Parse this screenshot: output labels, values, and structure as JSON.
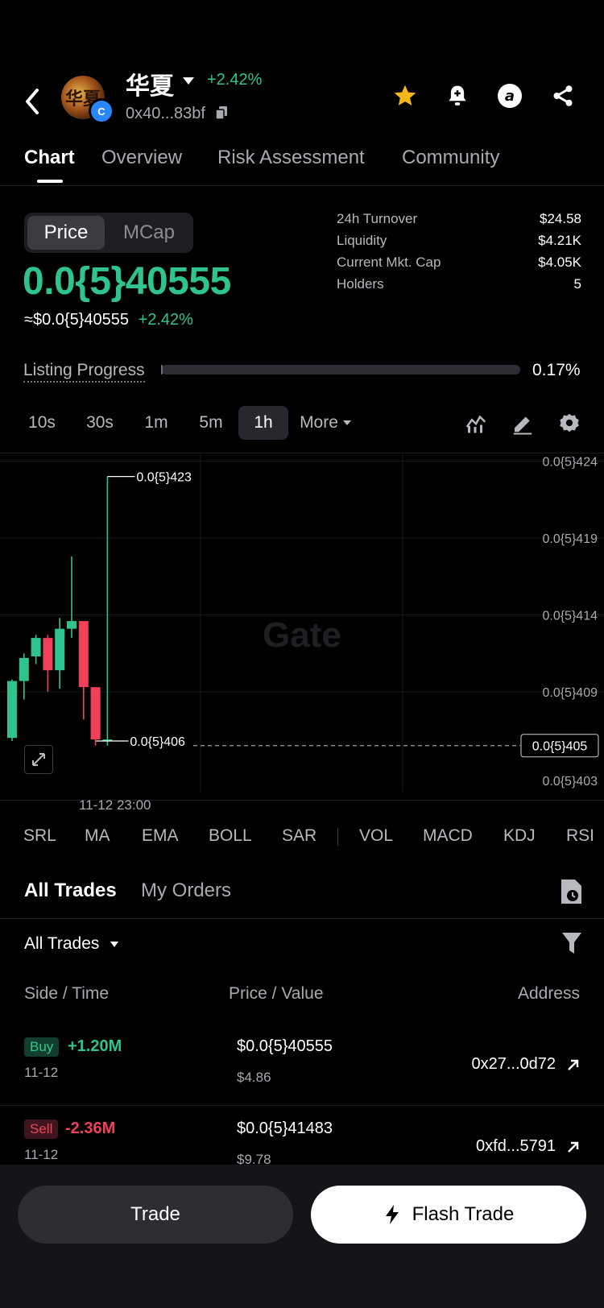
{
  "header": {
    "token_name": "华夏",
    "token_change": "+2.42%",
    "token_address": "0x40...83bf",
    "icons": [
      "back-arrow-icon",
      "star-icon",
      "bell-plus-icon",
      "alpha-icon",
      "share-icon"
    ]
  },
  "tabs": [
    "Chart",
    "Overview",
    "Risk Assessment",
    "Community"
  ],
  "price_toggle": {
    "price": "Price",
    "mcap": "MCap"
  },
  "price": {
    "main": "0.0{5}40555",
    "usd": "≈$0.0{5}40555",
    "change": "+2.42%"
  },
  "stats": [
    {
      "label": "24h Turnover",
      "value": "$24.58"
    },
    {
      "label": "Liquidity",
      "value": "$4.21K"
    },
    {
      "label": "Current Mkt. Cap",
      "value": "$4.05K"
    },
    {
      "label": "Holders",
      "value": "5"
    }
  ],
  "listing": {
    "label": "Listing Progress",
    "percent_text": "0.17%",
    "progress_fraction": 0.0017
  },
  "timeframes": [
    "10s",
    "30s",
    "1m",
    "5m",
    "1h"
  ],
  "timeframe_more": "More",
  "active_timeframe": "1h",
  "chart_data": {
    "type": "candlestick",
    "y_ticks": [
      "0.0{5}424",
      "0.0{5}419",
      "0.0{5}414",
      "0.0{5}409",
      "0.0{5}403"
    ],
    "ylim": [
      4.025,
      4.245
    ],
    "x_label": "11-12 23:00",
    "high_label": "0.0{5}423",
    "low_label": "0.0{5}406",
    "current_label": "0.0{5}405",
    "current_value": 4.055,
    "watermark": "Gate",
    "candles": [
      {
        "o": 4.06,
        "h": 4.098,
        "l": 4.058,
        "c": 4.097
      },
      {
        "o": 4.097,
        "h": 4.115,
        "l": 4.085,
        "c": 4.112
      },
      {
        "o": 4.113,
        "h": 4.127,
        "l": 4.108,
        "c": 4.125
      },
      {
        "o": 4.125,
        "h": 4.127,
        "l": 4.09,
        "c": 4.104
      },
      {
        "o": 4.104,
        "h": 4.138,
        "l": 4.092,
        "c": 4.131
      },
      {
        "o": 4.131,
        "h": 4.178,
        "l": 4.125,
        "c": 4.136
      },
      {
        "o": 4.136,
        "h": 4.136,
        "l": 4.072,
        "c": 4.093
      },
      {
        "o": 4.093,
        "h": 4.093,
        "l": 4.055,
        "c": 4.059
      },
      {
        "o": 4.059,
        "h": 4.23,
        "l": 4.055,
        "c": 4.059
      }
    ]
  },
  "indicators": [
    "SRL",
    "MA",
    "EMA",
    "BOLL",
    "SAR",
    "VOL",
    "MACD",
    "KDJ",
    "RSI"
  ],
  "trades_tabs": [
    "All Trades",
    "My Orders"
  ],
  "trades_filter": "All Trades",
  "columns": {
    "side_time": "Side / Time",
    "price_value": "Price / Value",
    "address": "Address"
  },
  "trades": [
    {
      "side": "Buy",
      "amount": "+1.20M",
      "time": "11-12",
      "price": "$0.0{5}40555",
      "value": "$4.86",
      "address": "0x27...0d72"
    },
    {
      "side": "Sell",
      "amount": "-2.36M",
      "time": "11-12",
      "price": "$0.0{5}41483",
      "value": "$9.78",
      "address": "0xfd...5791"
    }
  ],
  "buttons": {
    "trade": "Trade",
    "flash_trade": "Flash Trade"
  },
  "colors": {
    "up": "#2fc48d",
    "down": "#f0405a"
  }
}
